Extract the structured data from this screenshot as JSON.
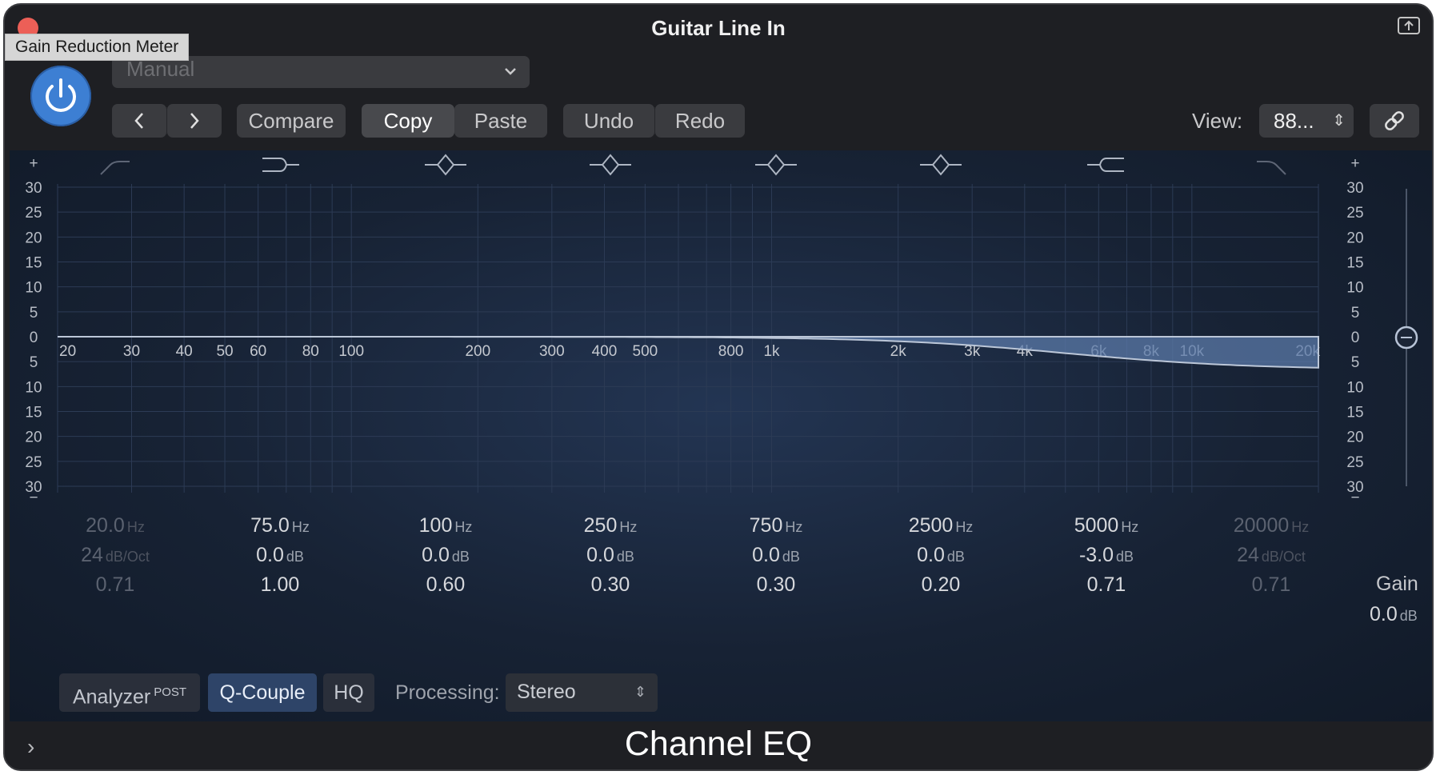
{
  "window": {
    "title": "Guitar Line In",
    "tooltip": "Gain Reduction Meter"
  },
  "header": {
    "preset": "Manual",
    "buttons": {
      "compare": "Compare",
      "copy": "Copy",
      "paste": "Paste",
      "undo": "Undo",
      "redo": "Redo"
    },
    "view_label": "View:",
    "view_value": "88..."
  },
  "eq": {
    "db_scale_left": [
      "30",
      "25",
      "20",
      "15",
      "10",
      "5",
      "0",
      "5",
      "10",
      "15",
      "20",
      "25",
      "30"
    ],
    "db_scale_right": [
      "30",
      "25",
      "20",
      "15",
      "10",
      "5",
      "0",
      "5",
      "10",
      "15",
      "20",
      "25",
      "30"
    ],
    "freq_labels": [
      "20",
      "30",
      "40",
      "50",
      "60",
      "80",
      "100",
      "200",
      "300",
      "400",
      "500",
      "800",
      "1k",
      "2k",
      "3k",
      "4k",
      "6k",
      "8k",
      "10k",
      "20k"
    ],
    "bands": [
      {
        "freq": "20.0",
        "freq_unit": "Hz",
        "gain": "24",
        "gain_unit": "dB/Oct",
        "q": "0.71",
        "enabled": false,
        "icon": "low-cut-icon"
      },
      {
        "freq": "75.0",
        "freq_unit": "Hz",
        "gain": "0.0",
        "gain_unit": "dB",
        "q": "1.00",
        "enabled": true,
        "icon": "low-shelf-icon"
      },
      {
        "freq": "100",
        "freq_unit": "Hz",
        "gain": "0.0",
        "gain_unit": "dB",
        "q": "0.60",
        "enabled": true,
        "icon": "bell-icon"
      },
      {
        "freq": "250",
        "freq_unit": "Hz",
        "gain": "0.0",
        "gain_unit": "dB",
        "q": "0.30",
        "enabled": true,
        "icon": "bell-icon"
      },
      {
        "freq": "750",
        "freq_unit": "Hz",
        "gain": "0.0",
        "gain_unit": "dB",
        "q": "0.30",
        "enabled": true,
        "icon": "bell-icon"
      },
      {
        "freq": "2500",
        "freq_unit": "Hz",
        "gain": "0.0",
        "gain_unit": "dB",
        "q": "0.20",
        "enabled": true,
        "icon": "bell-icon"
      },
      {
        "freq": "5000",
        "freq_unit": "Hz",
        "gain": "-3.0",
        "gain_unit": "dB",
        "q": "0.71",
        "enabled": true,
        "icon": "high-shelf-icon"
      },
      {
        "freq": "20000",
        "freq_unit": "Hz",
        "gain": "24",
        "gain_unit": "dB/Oct",
        "q": "0.71",
        "enabled": false,
        "icon": "high-cut-icon"
      }
    ],
    "gain_label": "Gain",
    "gain_value": "0.0",
    "gain_unit": "dB"
  },
  "options": {
    "analyzer": "Analyzer",
    "analyzer_mode": "POST",
    "q_couple": "Q-Couple",
    "hq": "HQ",
    "processing_label": "Processing:",
    "processing_value": "Stereo"
  },
  "footer": {
    "plugin_name": "Channel EQ"
  },
  "colors": {
    "accent": "#3d7fd3",
    "curve_fill": "#5f7fb0",
    "background": "#1e1f23"
  }
}
